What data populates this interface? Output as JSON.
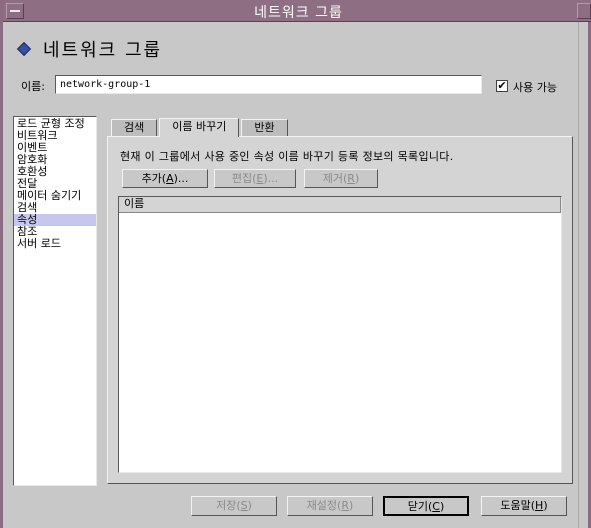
{
  "window": {
    "title": "네트워크 그룹"
  },
  "header": {
    "title": "네트워크 그룹"
  },
  "name_field": {
    "label": "이름:",
    "value": "network-group-1"
  },
  "enable_checkbox": {
    "label": "사용 가능",
    "checked": true,
    "mark": "✔"
  },
  "sidebar": {
    "items": [
      {
        "label": "로드 균형 조정"
      },
      {
        "label": "비트워크"
      },
      {
        "label": "이벤트"
      },
      {
        "label": "암호화"
      },
      {
        "label": "호환성"
      },
      {
        "label": "전달"
      },
      {
        "label": "메이터 숨기기"
      },
      {
        "label": "검색"
      },
      {
        "label": "속성",
        "selected": true
      },
      {
        "label": "참조"
      },
      {
        "label": "서버 로드"
      }
    ]
  },
  "tabs": [
    {
      "label": "검색"
    },
    {
      "label": "이름 바꾸기",
      "active": true
    },
    {
      "label": "반환"
    }
  ],
  "panel": {
    "description": "현재 이 그룹에서 사용 중인 속성 이름 바꾸기 등록 정보의 목록입니다.",
    "add_button": {
      "label": "추가(",
      "mnemonic": "A",
      "suffix": ")..."
    },
    "edit_button": {
      "label": "편집(",
      "mnemonic": "E",
      "suffix": ")..."
    },
    "remove_button": {
      "label": "제거(",
      "mnemonic": "R",
      "suffix": ")"
    },
    "table": {
      "columns": [
        "이름"
      ],
      "rows": []
    }
  },
  "footer": {
    "save": {
      "label": "저장(",
      "mnemonic": "S",
      "suffix": ")"
    },
    "reset": {
      "label": "재설정(",
      "mnemonic": "R",
      "suffix": ")"
    },
    "close": {
      "label": "닫기(",
      "mnemonic": "C",
      "suffix": ")"
    },
    "help": {
      "label": "도움말(",
      "mnemonic": "H",
      "suffix": ")"
    }
  },
  "colors": {
    "titlebar": "#8e6e82",
    "background": "#c8c8c8",
    "selection": "#c6c6ee",
    "header_icon": "#3a4fa0"
  },
  "icons": {
    "header": "diamond-icon",
    "window_menu": "window-menu-icon"
  }
}
